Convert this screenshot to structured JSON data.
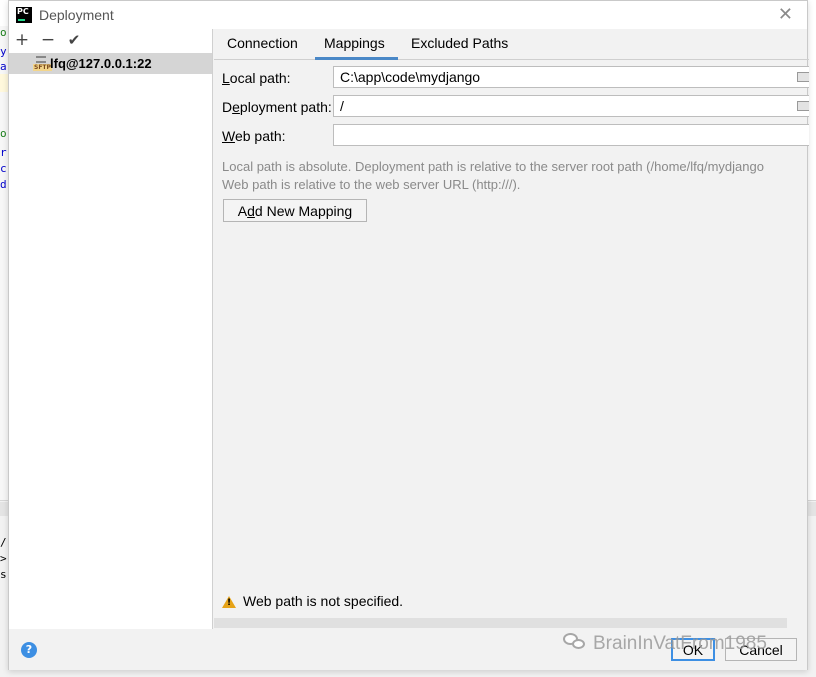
{
  "background": {
    "left_chars": [
      {
        "text": "o",
        "color": "#1a7f1a"
      },
      {
        "text": "y",
        "color": "#0000cc"
      },
      {
        "text": "a",
        "color": "#0000cc"
      },
      {
        "text": "o",
        "color": "#1a7f1a"
      },
      {
        "text": "r",
        "color": "#0000cc"
      },
      {
        "text": "c",
        "color": "#0000cc"
      },
      {
        "text": "d",
        "color": "#0000cc"
      }
    ],
    "bottom_chars": [
      "/",
      ">",
      "s"
    ]
  },
  "dialog": {
    "title": "Deployment",
    "close_icon": "close-icon"
  },
  "left_panel": {
    "toolbar": {
      "add_icon": "+",
      "remove_icon": "−",
      "apply_icon": "✔"
    },
    "servers": [
      {
        "name": "lfq@127.0.0.1:22",
        "icon": "sftp-icon",
        "icon_label": "SFTP"
      }
    ]
  },
  "tabs": [
    {
      "label": "Connection",
      "active": false
    },
    {
      "label": "Mappings",
      "active": true
    },
    {
      "label": "Excluded Paths",
      "active": false
    }
  ],
  "mappings": {
    "local_path": {
      "label_mnemonic": "L",
      "label_rest": "ocal path:",
      "value": "C:\\app\\code\\mydjango"
    },
    "deployment_path": {
      "label_start": "D",
      "label_mnemonic": "e",
      "label_rest": "ployment path:",
      "value": "/"
    },
    "web_path": {
      "label_mnemonic": "W",
      "label_rest": "eb path:",
      "value": ""
    },
    "hint_line1": "Local path is absolute. Deployment path is relative to the server root path (/home/lfq/mydjango",
    "hint_line2": "Web path is relative to the web server URL (http:///).",
    "add_button": {
      "prefix": "A",
      "mnemonic": "d",
      "rest": "d New Mapping"
    }
  },
  "warning": {
    "icon": "warning-icon",
    "text": "Web path is not specified."
  },
  "footer": {
    "help_label": "?",
    "ok_label": "OK",
    "cancel_label": "Cancel"
  },
  "watermark": {
    "text": "BrainInVatFrom1985",
    "icon": "wechat-icon"
  },
  "colors": {
    "accent": "#4a88c7",
    "help_blue": "#3d8fe3",
    "warning": "#e6a317",
    "hint_gray": "#8a8a8a",
    "selection": "#d5d5d5"
  }
}
